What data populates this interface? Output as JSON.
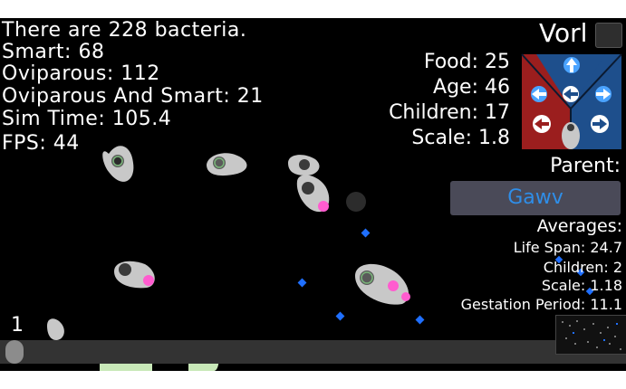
{
  "stats": {
    "bacteria_count": "There are 228 bacteria.",
    "smart": "Smart: 68",
    "oviparous": "Oviparous: 112",
    "oviparous_smart": "Oviparous And Smart: 21",
    "sim_time": "Sim Time: 105.4",
    "fps": "FPS: 44"
  },
  "selected": {
    "name": "Vorl",
    "food": "Food: 25",
    "age": "Age: 46",
    "children": "Children: 17",
    "scale": "Scale: 1.8",
    "parent_label": "Parent:",
    "parent_name": "Gawv"
  },
  "averages": {
    "title": "Averages:",
    "life_span": "Life Span: 24.7",
    "children": "Children: 2",
    "scale": "Scale: 1.18",
    "gestation": "Gestation Period: 11.1"
  },
  "timeline": {
    "generation": "1"
  },
  "colors": {
    "background": "#000000",
    "bacteria_body": "#c8c8c8",
    "egg_pink": "#ff5ccf",
    "food_blue": "#1f6fff",
    "pad_left": "#9b1e1e",
    "pad_right": "#1e4f8c",
    "pad_arrow": "#4aa3ff",
    "parent_text": "#2f8ee8"
  },
  "icons": {
    "up": "arrow-up-icon",
    "left": "arrow-left-icon",
    "right": "arrow-right-icon",
    "rotate_left": "rotate-left-icon",
    "rotate_right": "rotate-right-icon"
  }
}
